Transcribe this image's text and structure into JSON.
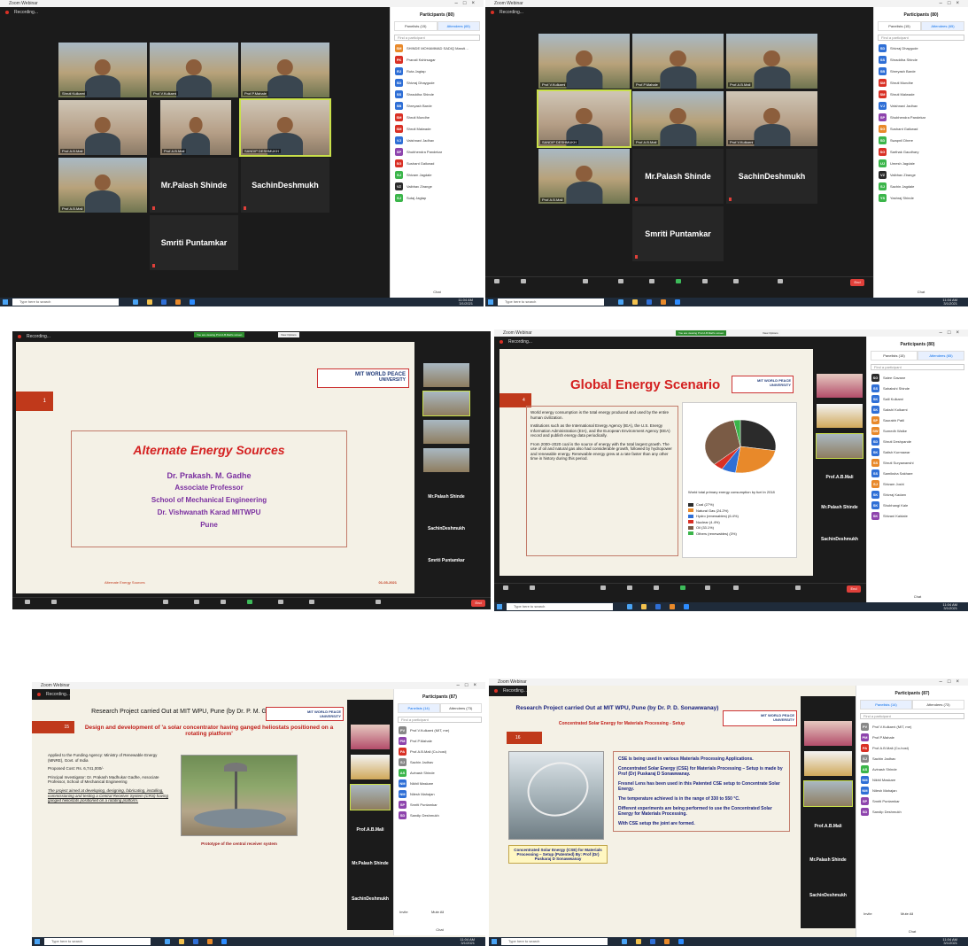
{
  "window": {
    "title": "Zoom Webinar",
    "recording": "Recording...",
    "view_options": "View Options",
    "sharing_banner": "You are viewing Prof.A.B.Mali's screen",
    "end": "End"
  },
  "participants_panel": {
    "title": "Participants (80)",
    "title2": "Participants (87)",
    "tab_panelists": "Panelists (15)",
    "tab_attendees": "Attendees (65)",
    "tab_panelists_b": "Panelists (14)",
    "tab_attendees_b": "Attendees (73)",
    "search_placeholder": "Find a participant",
    "chat": "Chat",
    "invite": "Invite",
    "mute_all": "Mute All",
    "attendees_list": [
      "SHINDE MOHAMMAD SADIQ Maruti…",
      "Pranali Kshirsagar",
      "Ruta Jagtap",
      "Shivraj Dhaygude",
      "Shraddha Shinde",
      "Shreyash Barde",
      "Shruti Mundhe",
      "Shruti Malwade",
      "Vaishnavi Jadhav",
      "Shubhendra Pandekar",
      "Sushant Gaikwad",
      "Shivam Jagdale",
      "Vaibhav Zirange",
      "Sutaj Jagtap"
    ],
    "attendees_list_b": [
      "Shivraj Dhaygude",
      "Shraddha Shinde",
      "Shreyash Barde",
      "Shruti Mundhe",
      "Shruti Malwade",
      "Vaishnavi Jadhav",
      "Shubhendra Pandekar",
      "Sushant Gaikwad",
      "Swapnil Dhere",
      "Sarthak Gaudhary",
      "Umesh Jagdale",
      "Vaibhav Zirange",
      "Sachin Jagdale",
      "Yashraj Shinde"
    ],
    "attendees_list_c": [
      "Saiee Gavane",
      "Sahakshi Shinde",
      "Salil Kulkarni",
      "Sakshi Kulkarni",
      "Saurabh Patil",
      "Sumedh Walke",
      "Shruti Deshpande",
      "Satish Kurmawar",
      "Shruti Suryawanshi",
      "Samiksha Sakhare",
      "Shivam Joshi",
      "Shivraj Kadam",
      "Shubhangi Kale",
      "Shivani Kaldate"
    ],
    "panelists_list": [
      "Prof.V.Kulkarni (MIT, me)",
      "Prof.P.Mahale",
      "Prof.A.B.Mali (Co-host)",
      "Sachin Jadhav",
      "Avinash Shinde",
      "Nikhil Maskare",
      "Nilesh Mahajan",
      "Smriti Puntamkar",
      "Sandip Deshmukh"
    ]
  },
  "gallery": {
    "names_a": [
      "Shruti Kulkarni",
      "Prof.V.Kulkarni",
      "Prof.P.Mahale",
      "Prof.A.B.Mali",
      "Prof.A.B.Mali",
      "SANDIP DESHMUKH",
      "Prof.A.B.Mali"
    ],
    "big_tiles": [
      "Mr.Palash Shinde",
      "SachinDeshmukh",
      "Smriti Puntamkar"
    ],
    "names_b": [
      "Prof.V.Kulkarni",
      "Prof.P.Mahale",
      "Prof.A.B.Mali",
      "SANDIP DESHMUKH",
      "Prof.A.B.Mali",
      "Prof.V.Kulkarni",
      "Prof.A.B.Mali"
    ]
  },
  "sidebar_names": [
    "Prof.A.B.Mali",
    "Mr.Palash Shinde",
    "SachinDeshmukh",
    "Smriti Puntamkar"
  ],
  "slides": {
    "s1": {
      "number": "1",
      "title": "Alternate Energy Sources",
      "author": "Dr. Prakash. M. Gadhe",
      "role": "Associate Professor",
      "school": "School of Mechanical Engineering",
      "univ": "Dr. Vishwanath Karad MITWPU",
      "city": "Pune",
      "footer_left": "Alternate Energy Sources",
      "footer_right": "01-03-2021"
    },
    "s2": {
      "number": "4",
      "title": "Global Energy Scenario",
      "bullet1": "World energy consumption is the total energy produced and used by the entire human civilization.",
      "bullet2": "Institutions such as the International Energy Agency (IEA), the U.S. Energy Information Administration (EIA), and the European Environment Agency (EEA) record and publish energy data periodically.",
      "bullet3": "From 2000–2020 coal is the source of energy with the total largest growth. The use of oil and natural gas also had considerable growth, followed by hydropower and renewable energy. Renewable energy grew at a rate faster than any other time in history during this period.",
      "chart_caption": "World total primary energy consumption by fuel in 2018",
      "legend": [
        "Coal (27%)",
        "Natural Gas (24.2%)",
        "Hydro (renewables) (6.4%)",
        "Nuclear (4.4%)",
        "Oil (33.1%)",
        "Others (renewables) (3%)"
      ],
      "legend_colors": [
        "#2b2b2b",
        "#e8892a",
        "#2f6fd6",
        "#d93025",
        "#7a5b45",
        "#3bb54a"
      ]
    },
    "s3": {
      "number": "15",
      "header": "Research Project carried Out at MIT WPU, Pune (by Dr. P. M. Gadhe)",
      "subtitle": "Design and development of 'a solar concentrator having ganged heliostats positioned on a rotating platform'",
      "b1": "Applied to the Funding Agency: Ministry of Renewable Energy (MNRE), Govt. of India",
      "b2": "Proposed Cost: Rs. 6,741,000/-",
      "b3": "Principal Investigator: Dr. Prakash Madhukar Gadhe, Associate Professor, School of Mechanical Engineering",
      "b4": "The project aimed at developing, designing, fabricating, installing, commissioning and testing a Central Receiver System (CRS) having ganged heliostats positioned on a rotating platform.",
      "caption": "Prototype of the central receiver system"
    },
    "s4": {
      "number": "16",
      "header": "Research Project carried Out at MIT WPU, Pune (by Dr. P. D. Sonawwanay)",
      "subtitle": "Concentrated Solar Energy for Materials Processing - Setup",
      "b1": "CSE is being used in various Materials Processing Applications.",
      "b2": "Concentrated Solar Energy (CSE) for Materials Processing – Setup is made by Prof (Dr) Puskaraj D Sonawwanay.",
      "b3": "Fresnel Lens has been used in this Patented CSE setup to Concentrate Solar Energy.",
      "b4": "The temperature achieved is in the range of 330 to 550 °C.",
      "b5": "Different experiments are being performed to use the Concentrated Solar Energy for Materials Processing.",
      "b6": "With CSE setup the joint are formed.",
      "caption": "Concentrated Solar Energy (CSE) for Materials Processing – Setup (Patented) By: Prof (Dr) Puskaraj D Sonawwanay"
    }
  },
  "university": {
    "line1": "MIT WORLD PEACE",
    "line2": "UNIVERSITY",
    "abbr": "MIT-WPU"
  },
  "taskbar": {
    "search": "Type here to search",
    "time": "11:04 AM",
    "date": "3/1/2021"
  }
}
